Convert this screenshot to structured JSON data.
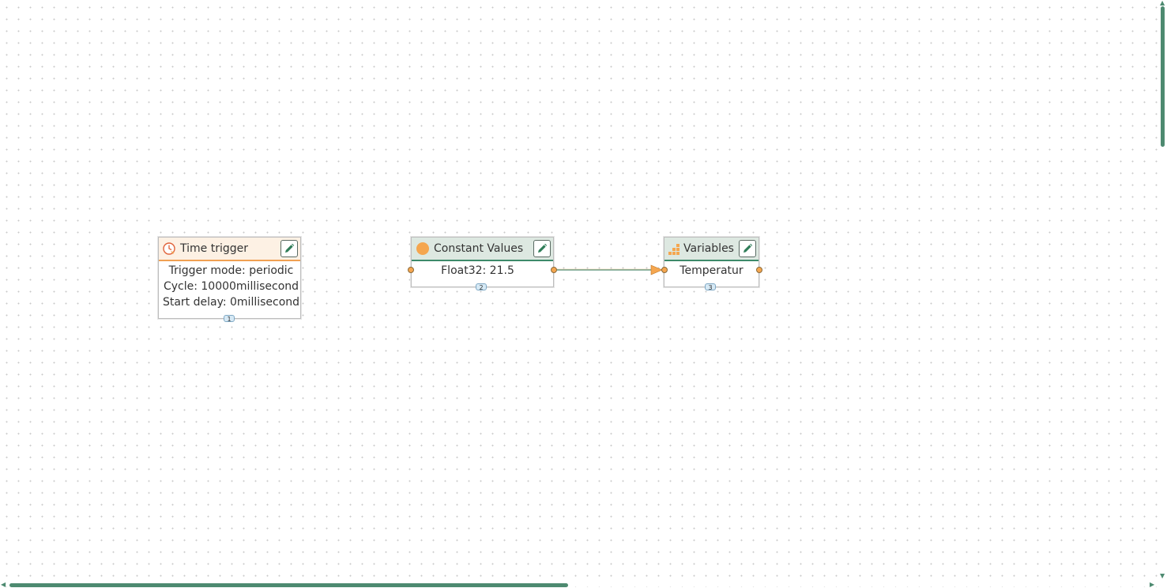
{
  "nodes": [
    {
      "badge": "1",
      "title": "Time trigger",
      "icon": "clock-icon",
      "lines": [
        "Trigger mode: periodic",
        "Cycle: 10000millisecond",
        "Start delay: 0millisecond"
      ]
    },
    {
      "badge": "2",
      "title": "Constant Values",
      "icon": "circle-icon",
      "lines": [
        "Float32: 21.5"
      ]
    },
    {
      "badge": "3",
      "title": "Variables",
      "icon": "bar-steps-icon",
      "lines": [
        "Temperatur"
      ]
    }
  ],
  "connections": [
    {
      "from": "2",
      "to": "3"
    }
  ],
  "colors": {
    "accent_green": "#3d8a6a",
    "accent_orange": "#f0a052",
    "port": "#f5a64f"
  }
}
